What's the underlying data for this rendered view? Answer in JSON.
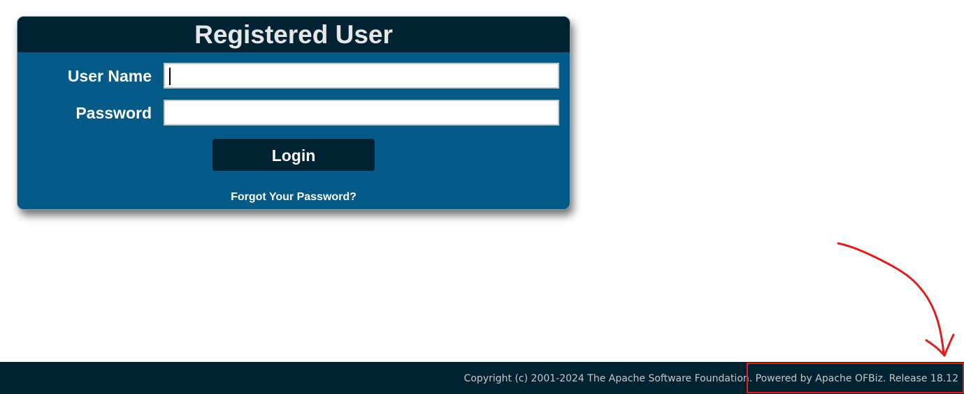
{
  "login": {
    "title": "Registered User",
    "username_label": "User Name",
    "username_value": "",
    "password_label": "Password",
    "password_value": "",
    "login_button": "Login",
    "forgot_link": "Forgot Your Password?"
  },
  "footer": {
    "copyright": "Copyright (c) 2001-2024 The Apache Software Foundation. ",
    "powered_by": "Powered by Apache OFBiz. Release 18.12"
  },
  "colors": {
    "panel_bg": "#035a87",
    "header_bg": "#002233",
    "footer_bg": "#002233",
    "annotation_red": "#e01e1e"
  },
  "icons": {
    "annotation": "hand-drawn-arrow-icon"
  }
}
